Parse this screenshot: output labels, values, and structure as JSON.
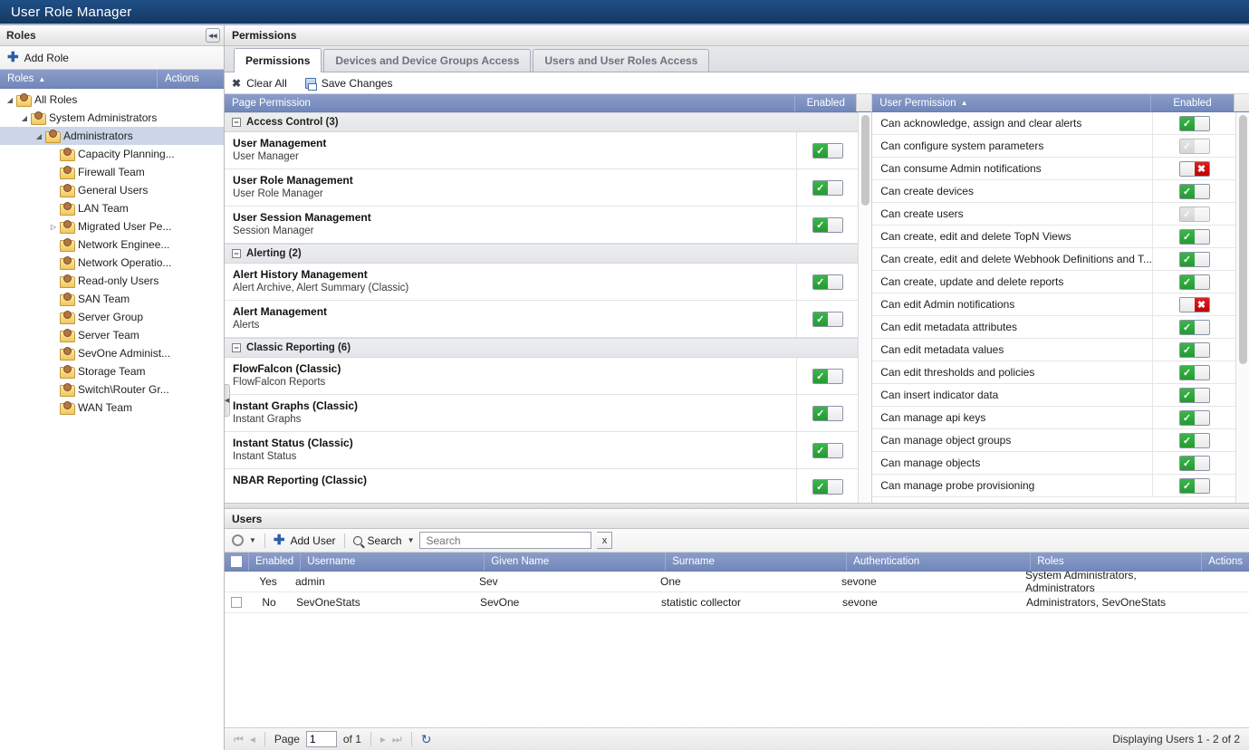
{
  "window": {
    "title": "User Role Manager"
  },
  "roles_panel": {
    "header": "Roles",
    "collapse_icon": "collapse-left-icon",
    "add_role_label": "Add Role",
    "grid_columns": {
      "roles": "Roles",
      "actions": "Actions"
    },
    "tree": [
      {
        "label": "All Roles",
        "depth": 0,
        "expander": "expanded",
        "selected": false
      },
      {
        "label": "System Administrators",
        "depth": 1,
        "expander": "expanded",
        "selected": false
      },
      {
        "label": "Administrators",
        "depth": 2,
        "expander": "expanded",
        "selected": true
      },
      {
        "label": "Capacity Planning...",
        "depth": 3,
        "expander": "none",
        "selected": false
      },
      {
        "label": "Firewall Team",
        "depth": 3,
        "expander": "none",
        "selected": false
      },
      {
        "label": "General Users",
        "depth": 3,
        "expander": "none",
        "selected": false
      },
      {
        "label": "LAN Team",
        "depth": 3,
        "expander": "none",
        "selected": false
      },
      {
        "label": "Migrated User Pe...",
        "depth": 3,
        "expander": "collapsed",
        "selected": false
      },
      {
        "label": "Network Enginee...",
        "depth": 3,
        "expander": "none",
        "selected": false
      },
      {
        "label": "Network Operatio...",
        "depth": 3,
        "expander": "none",
        "selected": false
      },
      {
        "label": "Read-only Users",
        "depth": 3,
        "expander": "none",
        "selected": false
      },
      {
        "label": "SAN Team",
        "depth": 3,
        "expander": "none",
        "selected": false
      },
      {
        "label": "Server Group",
        "depth": 3,
        "expander": "none",
        "selected": false
      },
      {
        "label": "Server Team",
        "depth": 3,
        "expander": "none",
        "selected": false
      },
      {
        "label": "SevOne Administ...",
        "depth": 3,
        "expander": "none",
        "selected": false
      },
      {
        "label": "Storage Team",
        "depth": 3,
        "expander": "none",
        "selected": false
      },
      {
        "label": "Switch\\Router Gr...",
        "depth": 3,
        "expander": "none",
        "selected": false
      },
      {
        "label": "WAN Team",
        "depth": 3,
        "expander": "none",
        "selected": false
      }
    ]
  },
  "permissions": {
    "header": "Permissions",
    "tabs": [
      {
        "label": "Permissions",
        "active": true
      },
      {
        "label": "Devices and Device Groups Access",
        "active": false
      },
      {
        "label": "Users and User Roles Access",
        "active": false
      }
    ],
    "toolbar": {
      "clear_all": "Clear All",
      "save_changes": "Save Changes"
    },
    "page_grid": {
      "columns": {
        "name": "Page Permission",
        "enabled": "Enabled"
      },
      "groups": [
        {
          "title": "Access Control (3)",
          "rows": [
            {
              "name": "User Management",
              "sub": "User Manager",
              "state": "on"
            },
            {
              "name": "User Role Management",
              "sub": "User Role Manager",
              "state": "on"
            },
            {
              "name": "User Session Management",
              "sub": "Session Manager",
              "state": "on"
            }
          ]
        },
        {
          "title": "Alerting (2)",
          "rows": [
            {
              "name": "Alert History Management",
              "sub": "Alert Archive, Alert Summary (Classic)",
              "state": "on"
            },
            {
              "name": "Alert Management",
              "sub": "Alerts",
              "state": "on"
            }
          ]
        },
        {
          "title": "Classic Reporting (6)",
          "rows": [
            {
              "name": "FlowFalcon (Classic)",
              "sub": "FlowFalcon Reports",
              "state": "on"
            },
            {
              "name": "Instant Graphs (Classic)",
              "sub": "Instant Graphs",
              "state": "on"
            },
            {
              "name": "Instant Status (Classic)",
              "sub": "Instant Status",
              "state": "on"
            },
            {
              "name": "NBAR Reporting (Classic)",
              "sub": "",
              "state": "on"
            }
          ]
        }
      ]
    },
    "user_grid": {
      "columns": {
        "name": "User Permission",
        "enabled": "Enabled"
      },
      "sort_indicator": "sort-asc-icon",
      "rows": [
        {
          "name": "Can acknowledge, assign and clear alerts",
          "state": "on"
        },
        {
          "name": "Can configure system parameters",
          "state": "disabled"
        },
        {
          "name": "Can consume Admin notifications",
          "state": "off"
        },
        {
          "name": "Can create devices",
          "state": "on"
        },
        {
          "name": "Can create users",
          "state": "disabled"
        },
        {
          "name": "Can create, edit and delete TopN Views",
          "state": "on"
        },
        {
          "name": "Can create, edit and delete Webhook Definitions and T...",
          "state": "on"
        },
        {
          "name": "Can create, update and delete reports",
          "state": "on"
        },
        {
          "name": "Can edit Admin notifications",
          "state": "off"
        },
        {
          "name": "Can edit metadata attributes",
          "state": "on"
        },
        {
          "name": "Can edit metadata values",
          "state": "on"
        },
        {
          "name": "Can edit thresholds and policies",
          "state": "on"
        },
        {
          "name": "Can insert indicator data",
          "state": "on"
        },
        {
          "name": "Can manage api keys",
          "state": "on"
        },
        {
          "name": "Can manage object groups",
          "state": "on"
        },
        {
          "name": "Can manage objects",
          "state": "on"
        },
        {
          "name": "Can manage probe provisioning",
          "state": "on"
        }
      ]
    }
  },
  "users": {
    "header": "Users",
    "toolbar": {
      "gear_icon": "gear-icon",
      "add_user": "Add User",
      "search_menu": "Search",
      "search_value": "",
      "search_placeholder": "Search",
      "clear_label": "x"
    },
    "columns": {
      "enabled": "Enabled",
      "username": "Username",
      "given_name": "Given Name",
      "surname": "Surname",
      "authentication": "Authentication",
      "roles": "Roles",
      "actions": "Actions"
    },
    "rows": [
      {
        "checkbox": false,
        "show_checkbox": false,
        "enabled": "Yes",
        "username": "admin",
        "given_name": "Sev",
        "surname": "One",
        "authentication": "sevone",
        "roles": "System Administrators, Administrators"
      },
      {
        "checkbox": false,
        "show_checkbox": true,
        "enabled": "No",
        "username": "SevOneStats",
        "given_name": "SevOne",
        "surname": "statistic collector",
        "authentication": "sevone",
        "roles": "Administrators, SevOneStats"
      }
    ],
    "pager": {
      "first": "first-page-icon",
      "prev": "prev-page-icon",
      "page_label": "Page",
      "page_value": "1",
      "of_label": "of 1",
      "next": "next-page-icon",
      "last": "last-page-icon",
      "refresh": "refresh-icon",
      "display_text": "Displaying Users 1 - 2 of 2"
    }
  },
  "colors": {
    "title_bar": "#1b4578",
    "grid_header": "#7287ba",
    "toggle_on": "#249b32",
    "toggle_off": "#c00000",
    "selection": "#ccd6e8"
  }
}
